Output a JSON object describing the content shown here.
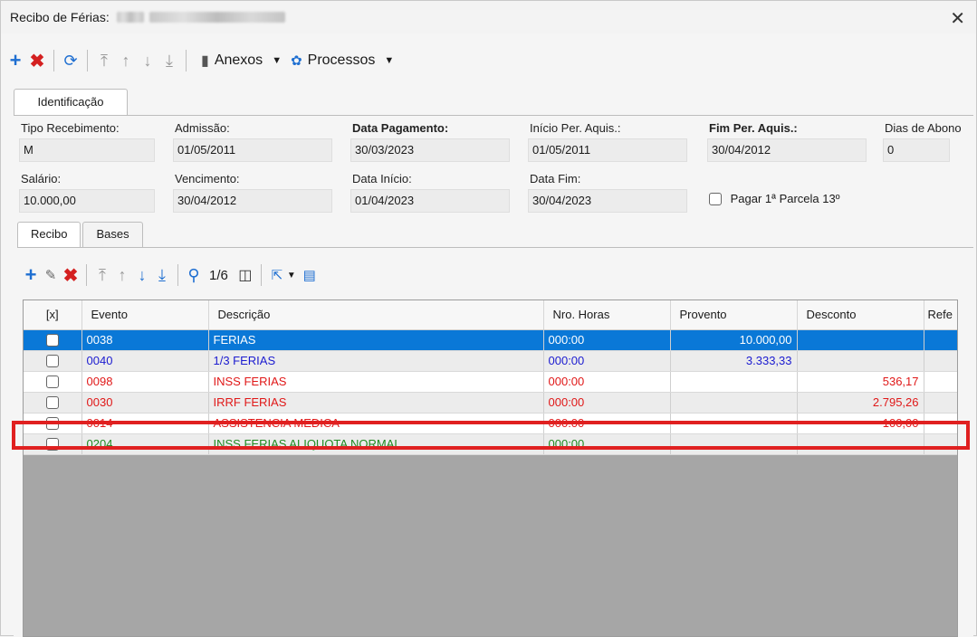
{
  "window": {
    "title": "Recibo de Férias:",
    "close_glyph": "✕"
  },
  "toolbar": {
    "icons": [
      "plus-icon",
      "x-icon",
      "refresh-icon",
      "first-icon",
      "up-icon",
      "down-icon",
      "last-icon"
    ],
    "anexos_label": "Anexos",
    "processos_label": "Processos"
  },
  "outer_tab": {
    "label": "Identificação"
  },
  "fields": {
    "tipo_recebimento": {
      "label": "Tipo Recebimento:",
      "value": "M"
    },
    "admissao": {
      "label": "Admissão:",
      "value": "01/05/2011"
    },
    "data_pagamento": {
      "label": "Data Pagamento:",
      "value": "30/03/2023"
    },
    "inicio_per_aquis": {
      "label": "Início Per. Aquis.:",
      "value": "01/05/2011"
    },
    "fim_per_aquis": {
      "label": "Fim Per. Aquis.:",
      "value": "30/04/2012"
    },
    "dias_abono": {
      "label": "Dias de Abono",
      "value": "0"
    },
    "salario": {
      "label": "Salário:",
      "value": "10.000,00"
    },
    "vencimento": {
      "label": "Vencimento:",
      "value": "30/04/2012"
    },
    "data_inicio": {
      "label": "Data Início:",
      "value": "01/04/2023"
    },
    "data_fim": {
      "label": "Data Fim:",
      "value": "30/04/2023"
    },
    "pagar_13": {
      "label": "Pagar 1ª Parcela 13º"
    }
  },
  "inner_tabs": [
    {
      "label": "Recibo"
    },
    {
      "label": "Bases"
    }
  ],
  "grid_toolbar": {
    "counter": "1/6"
  },
  "table": {
    "headers": [
      "[x]",
      "Evento",
      "Descrição",
      "Nro. Horas",
      "Provento",
      "Desconto",
      "Refe"
    ],
    "rows": [
      {
        "evento": "0038",
        "descricao": "FERIAS",
        "horas": "000:00",
        "provento": "10.000,00",
        "desconto": "",
        "color": "#ffffff"
      },
      {
        "evento": "0040",
        "descricao": "1/3 FERIAS",
        "horas": "000:00",
        "provento": "3.333,33",
        "desconto": "",
        "color": "#1c1cd0"
      },
      {
        "evento": "0098",
        "descricao": "INSS FERIAS",
        "horas": "000:00",
        "provento": "",
        "desconto": "536,17",
        "color": "#e01818"
      },
      {
        "evento": "0030",
        "descricao": "IRRF FERIAS",
        "horas": "000:00",
        "provento": "",
        "desconto": "2.795,26",
        "color": "#e01818"
      },
      {
        "evento": "0014",
        "descricao": "ASSISTENCIA MEDICA",
        "horas": "000:00",
        "provento": "",
        "desconto": "100,00",
        "color": "#e01818"
      },
      {
        "evento": "0204",
        "descricao": "INSS FERIAS ALIQUOTA NORMAL",
        "horas": "000:00",
        "provento": "",
        "desconto": "",
        "color": "#1f8a1f"
      }
    ]
  },
  "colors": {
    "selection": "#0a78d7",
    "highlight_border": "#e02020"
  }
}
